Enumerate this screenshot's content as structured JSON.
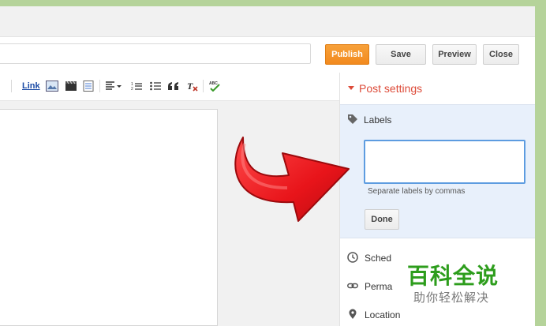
{
  "toolbar": {
    "publish_label": "Publish",
    "save_label": "Save",
    "preview_label": "Preview",
    "close_label": "Close",
    "link_label": "Link"
  },
  "sidebar": {
    "header": "Post settings",
    "labels": {
      "title": "Labels",
      "help": "Separate labels by commas",
      "done_label": "Done",
      "value": ""
    },
    "items": [
      {
        "label": "Sched",
        "icon": "clock-icon"
      },
      {
        "label": "Perma",
        "icon": "link-icon"
      },
      {
        "label": "Location",
        "icon": "location-pin-icon"
      }
    ]
  },
  "watermark": {
    "title": "百科全说",
    "subtitle": "助你轻松解决"
  },
  "colors": {
    "publish": "#f28a1e",
    "accent_red": "#dd4b39",
    "panel_bg": "#e8f0fb",
    "focus_border": "#5d9ce0",
    "watermark_green": "#2d9d1c",
    "arrow_red": "#e8141a"
  }
}
